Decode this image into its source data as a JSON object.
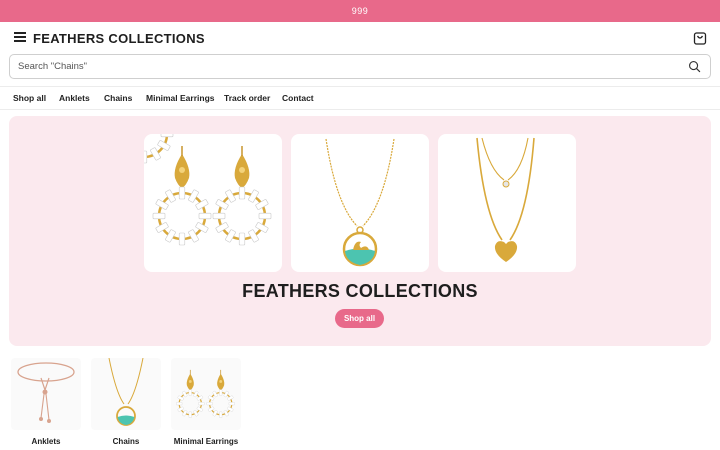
{
  "announcement": "999",
  "header": {
    "brand": "FEATHERS COLLECTIONS",
    "menu_icon": "hamburger-menu-icon",
    "cart_icon": "shopping-bag-icon"
  },
  "search": {
    "placeholder": "Search \"Chains\"",
    "value": "",
    "icon": "search-icon"
  },
  "nav": [
    "Shop all",
    "Anklets",
    "Chains",
    "Minimal Earrings",
    "Track order",
    "Contact"
  ],
  "hero": {
    "title": "FEATHERS COLLECTIONS",
    "button": "Shop all",
    "background": "#fbe9ee",
    "products": [
      "flower-earrings-image",
      "swan-pendant-necklace-image",
      "heart-layered-necklace-image"
    ]
  },
  "categories": [
    {
      "label": "Anklets",
      "image": "anklet-image"
    },
    {
      "label": "Chains",
      "image": "chain-pendant-image"
    },
    {
      "label": "Minimal Earrings",
      "image": "flower-earrings-image"
    }
  ],
  "colors": {
    "accent": "#e8698a",
    "hero_bg": "#fbe9ee",
    "gold": "#d9a93b"
  }
}
